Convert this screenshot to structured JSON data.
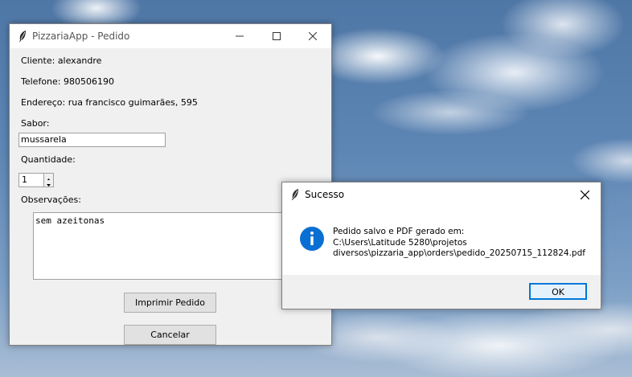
{
  "main_window": {
    "title": "PizzariaApp - Pedido",
    "cliente_text": "Cliente: alexandre",
    "telefone_text": "Telefone: 980506190",
    "endereco_text": "Endereço: rua francisco guimarães, 595",
    "sabor_label": "Sabor:",
    "sabor_value": "mussarela",
    "quantidade_label": "Quantidade:",
    "quantidade_value": "1",
    "observacoes_label": "Observações:",
    "observacoes_value": "sem azeitonas",
    "print_button": "Imprimir Pedido",
    "cancel_button": "Cancelar"
  },
  "dialog": {
    "title": "Sucesso",
    "icon": "info-icon",
    "message_line1": "Pedido salvo e PDF gerado em:",
    "message_line2": "C:\\Users\\Latitude 5280\\projetos",
    "message_line3": "diversos\\pizzaria_app\\orders\\pedido_20250715_112824.pdf",
    "ok_button": "OK"
  },
  "colors": {
    "info_icon": "#0a6fd2",
    "ok_border": "#0078d7"
  }
}
